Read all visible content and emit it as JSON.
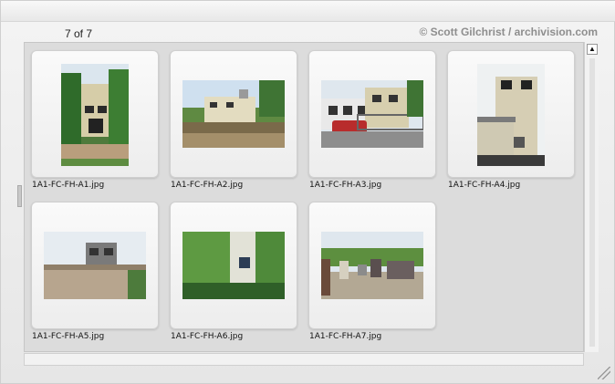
{
  "header": {
    "counter": "7 of 7",
    "credit": "© Scott Gilchrist / archivision.com"
  },
  "thumbnails": [
    {
      "filename": "1A1-FC-FH-A1.jpg"
    },
    {
      "filename": "1A1-FC-FH-A2.jpg"
    },
    {
      "filename": "1A1-FC-FH-A3.jpg"
    },
    {
      "filename": "1A1-FC-FH-A4.jpg"
    },
    {
      "filename": "1A1-FC-FH-A5.jpg"
    },
    {
      "filename": "1A1-FC-FH-A6.jpg"
    },
    {
      "filename": "1A1-FC-FH-A7.jpg"
    }
  ],
  "icons": {
    "scroll_up": "scroll-to-top-icon",
    "resize": "resize-grip-icon"
  }
}
